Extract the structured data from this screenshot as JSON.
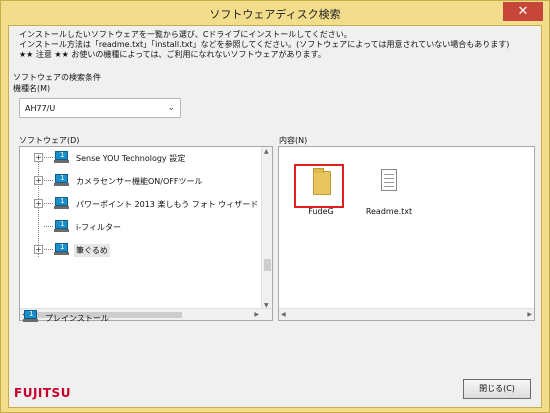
{
  "window": {
    "title": "ソフトウェアディスク検索",
    "close_glyph": "✕"
  },
  "instructions": [
    "インストールしたいソフトウェアを一覧から選び、Cドライブにインストールしてください。",
    "インストール方法は「readme.txt」「install.txt」などを参照してください。(ソフトウェアによっては用意されていない場合もあります)",
    "★★ 注意 ★★ お使いの機種によっては、ご利用になれないソフトウェアがあります。"
  ],
  "search": {
    "section_label": "ソフトウェアの検索条件",
    "model_label": "機種名(M)",
    "model_value": "AH77/U"
  },
  "software_panel": {
    "label": "ソフトウェア(D)",
    "items": [
      {
        "label": "Sense YOU Technology 設定",
        "expander": "+"
      },
      {
        "label": "カメラセンサー機能ON/OFFツール",
        "expander": "+"
      },
      {
        "label": "パワーポイント 2013 楽しもう フォト ウィザード",
        "expander": "+"
      },
      {
        "label": "i-フィルター",
        "expander": ""
      },
      {
        "label": "筆ぐるめ",
        "expander": "+"
      }
    ]
  },
  "contents_panel": {
    "label": "内容(N)",
    "files": [
      {
        "name": "FudeG",
        "icon": "folder-icon"
      },
      {
        "name": "Readme.txt",
        "icon": "text-file-icon"
      }
    ]
  },
  "preinstall_label": "プレインストール",
  "close_button": "閉じる(C)",
  "brand": "FUJITSU",
  "colors": {
    "frame": "#f2dd8c",
    "highlight": "#e02020",
    "brand": "#c9002b",
    "pc_icon": "#1b8fc9"
  }
}
